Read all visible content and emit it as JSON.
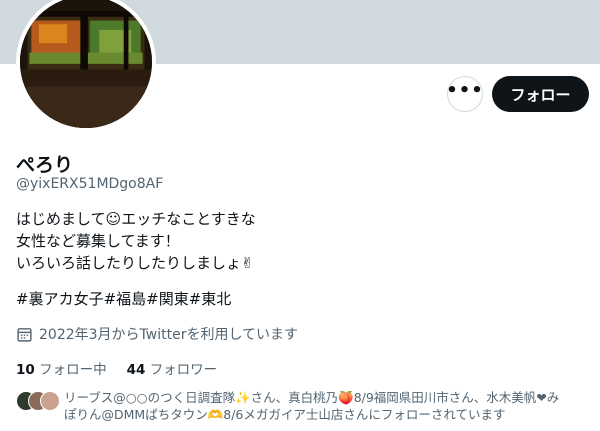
{
  "profile": {
    "display_name": "ぺろり",
    "handle": "@yixERX51MDgo8AF",
    "bio_lines": [
      "はじめまして☺エッチなことすきな",
      "女性など募集してます！",
      "いろいろ話したりしたりしましょ✌",
      "",
      "#裏アカ女子#福島#関東#東北"
    ],
    "joined": "2022年3月からTwitterを利用しています"
  },
  "actions": {
    "more_label": "•••",
    "follow_label": "フォロー"
  },
  "stats": {
    "following_count": "10",
    "following_label": "フォロー中",
    "followers_count": "44",
    "followers_label": "フォロワー"
  },
  "followed_by": {
    "line1": "リーブス@○○のつく日調査隊✨さん、真白桃乃🍑8/9福岡県田川市さん、水木美帆❤み",
    "line2": "ぽりん@DMMぱちタウン🫶8/6メガガイア士山店さんにフォローされています"
  },
  "colors": {
    "banner": "#cfd9de",
    "primary_text": "#0f1419",
    "secondary_text": "#536471",
    "follow_button": "#0f1419"
  },
  "icons": {
    "more": "more-horizontal-icon",
    "joined": "calendar-icon"
  }
}
